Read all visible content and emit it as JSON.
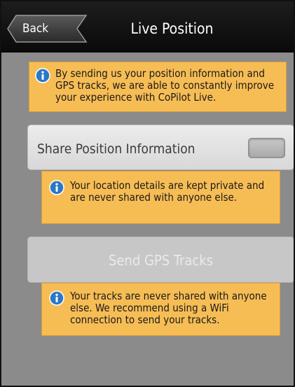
{
  "header": {
    "back_label": "Back",
    "title": "Live Position"
  },
  "intro": {
    "icon": "info-icon",
    "text": "By sending us your position information and GPS tracks, we are able to constantly improve your experience with CoPilot Live."
  },
  "share_position": {
    "label": "Share Position Information",
    "enabled": false
  },
  "share_note": {
    "icon": "info-icon",
    "text": "Your location details are kept private and are never shared with anyone else."
  },
  "send_tracks": {
    "label": "Send GPS Tracks",
    "disabled": true
  },
  "tracks_note": {
    "icon": "info-icon",
    "text": "Your tracks are never shared with anyone else. We recommend using a WiFi connection to send your tracks."
  },
  "colors": {
    "note_background": "#f7bd55",
    "page_background": "#8b8b8b",
    "header_background": "#111111",
    "info_icon": "#2a78c8"
  }
}
